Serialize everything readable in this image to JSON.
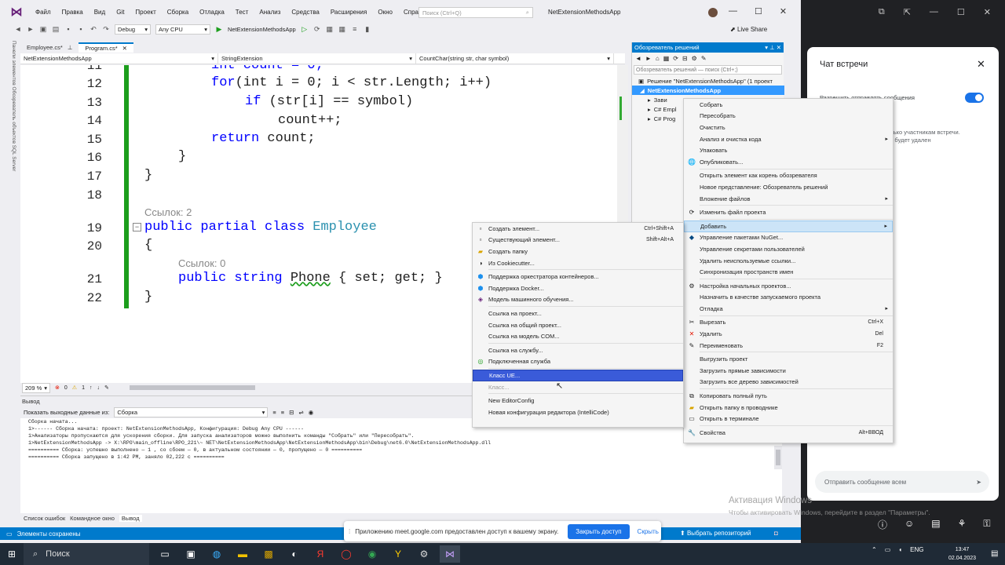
{
  "vs": {
    "menu": [
      "Файл",
      "Правка",
      "Вид",
      "Git",
      "Проект",
      "Сборка",
      "Отладка",
      "Тест",
      "Анализ",
      "Средства",
      "Расширения",
      "Окно",
      "Справка"
    ],
    "search_placeholder": "Поиск (Ctrl+Q)",
    "project_title": "NetExtensionMethodsApp",
    "toolbar": {
      "config": "Debug",
      "platform": "Any CPU",
      "run_target": "NetExtensionMethodsApp",
      "live_share": "Live Share"
    },
    "side_strip": "Панели элементов   Обозреватель объектов SQL Server",
    "tabs": [
      {
        "label": "Employee.cs*"
      },
      {
        "label": "Program.cs*"
      }
    ],
    "nav": {
      "project": "NetExtensionMethodsApp",
      "class": "StringExtension",
      "member": "CountChar(string str, char symbol)"
    },
    "code": {
      "line_numbers": [
        "11",
        "12",
        "13",
        "14",
        "15",
        "16",
        "17",
        "18",
        "19",
        "20",
        "21",
        "22"
      ],
      "l11": "int count = 0;",
      "l12_for": "for",
      "l12_rest": "(int i = 0; i < str.Length; i++)",
      "l13_if": "if",
      "l13_rest": " (str[i] == symbol)",
      "l14": "count++;",
      "l15_kw": "return",
      "l15_rest": " count;",
      "l16": "}",
      "l17": "}",
      "refs_class": "Ссылок: 2",
      "l19_kw": "public partial class",
      "l19_type": "Employee",
      "l20": "{",
      "refs_prop": "Ссылок: 0",
      "l21_kw": "public string",
      "l21_name": "Phone",
      "l21_rest": " { set; get; }",
      "l22": "}"
    },
    "zoom": "209 %",
    "errors": "0",
    "warnings": "1",
    "output": {
      "header": "Вывод",
      "show_from_label": "Показать выходные данные из:",
      "show_from_value": "Сборка",
      "lines": [
        "Сборка начата...",
        "1>------ Сборка начата: проект: NetExtensionMethodsApp, Конфигурация: Debug Any CPU ------",
        "1>Анализаторы пропускаются для ускорения сборки. Для запуска анализаторов можно выполнить команды \"Собрать\" или \"Пересобрать\".",
        "1>NetExtensionMethodsApp -> X:\\RPO\\main_offline\\RPO_221\\~ NET\\NetExtensionMethodsApp\\NetExtensionMethodsApp\\bin\\Debug\\net6.0\\NetExtensionMethodsApp.dll",
        "========== Сборка: успешно выполнено — 1 , со сбоем — 0, в актуальном состоянии — 0, пропущено — 0 ==========",
        "========== Сборка запущено в 1:42 PM, заняло 02,222 с =========="
      ]
    },
    "bottom_tabs": [
      "Список ошибок",
      "Командное окно",
      "Вывод"
    ],
    "status": "Элементы сохранены",
    "status_right": "Выбрать репозиторий"
  },
  "solution_explorer": {
    "title": "Обозреватель решений",
    "search": "Обозреватель решений — поиск (Ctrl+;)",
    "rows": [
      "Решение \"NetExtensionMethodsApp\" (1 проект",
      "NetExtensionMethodsApp",
      "Зави",
      "C# Empl",
      "C# Prog"
    ]
  },
  "context_menu": [
    {
      "icon": "",
      "label": "Собрать"
    },
    {
      "icon": "",
      "label": "Пересобрать"
    },
    {
      "icon": "",
      "label": "Очистить"
    },
    {
      "icon": "",
      "label": "Анализ и очистка кода",
      "arrow": true
    },
    {
      "icon": "",
      "label": "Упаковать"
    },
    {
      "icon": "globe-icon",
      "label": "Опубликовать..."
    },
    {
      "sep": true
    },
    {
      "icon": "",
      "label": "Открыть элемент как корень обозревателя"
    },
    {
      "icon": "",
      "label": "Новое представление: Обозреватель решений"
    },
    {
      "icon": "",
      "label": "Вложение файлов",
      "arrow": true
    },
    {
      "sep": true
    },
    {
      "icon": "refresh-icon",
      "label": "Изменить файл проекта"
    },
    {
      "sep": true
    },
    {
      "icon": "",
      "label": "Добавить",
      "arrow": true,
      "highlight": true
    },
    {
      "icon": "nuget-icon",
      "label": "Управление пакетами NuGet..."
    },
    {
      "icon": "",
      "label": "Управление секретами пользователей"
    },
    {
      "icon": "",
      "label": "Удалить неиспользуемые ссылки..."
    },
    {
      "icon": "",
      "label": "Синхронизация пространств имен"
    },
    {
      "sep": true
    },
    {
      "icon": "gear-icon",
      "label": "Настройка начальных проектов..."
    },
    {
      "icon": "",
      "label": "Назначить в качестве запускаемого проекта"
    },
    {
      "icon": "",
      "label": "Отладка",
      "arrow": true
    },
    {
      "sep": true
    },
    {
      "icon": "scissors-icon",
      "label": "Вырезать",
      "shortcut": "Ctrl+X"
    },
    {
      "icon": "delete-icon",
      "label": "Удалить",
      "shortcut": "Del"
    },
    {
      "icon": "rename-icon",
      "label": "Переименовать",
      "shortcut": "F2"
    },
    {
      "sep": true
    },
    {
      "icon": "",
      "label": "Выгрузить проект"
    },
    {
      "icon": "",
      "label": "Загрузить прямые зависимости"
    },
    {
      "icon": "",
      "label": "Загрузить все дерево зависимостей"
    },
    {
      "sep": true
    },
    {
      "icon": "copy-icon",
      "label": "Копировать полный путь"
    },
    {
      "icon": "folder-icon",
      "label": "Открыть папку в проводнике"
    },
    {
      "icon": "terminal-icon",
      "label": "Открыть в терминале"
    },
    {
      "sep": true
    },
    {
      "icon": "wrench-icon",
      "label": "Свойства",
      "shortcut": "Alt+ВВОД"
    }
  ],
  "submenu": [
    {
      "icon": "new-item-icon",
      "label": "Создать элемент...",
      "shortcut": "Ctrl+Shift+A"
    },
    {
      "icon": "existing-item-icon",
      "label": "Существующий элемент...",
      "shortcut": "Shift+Alt+A"
    },
    {
      "icon": "folder-icon",
      "label": "Создать папку"
    },
    {
      "icon": "cookiecutter-icon",
      "label": "Из Cookiecutter..."
    },
    {
      "sep": true
    },
    {
      "icon": "container-icon",
      "label": "Поддержка оркестратора контейнеров..."
    },
    {
      "icon": "docker-icon",
      "label": "Поддержка Docker..."
    },
    {
      "icon": "ml-icon",
      "label": "Модель машинного обучения..."
    },
    {
      "sep": true
    },
    {
      "icon": "",
      "label": "Ссылка на проект..."
    },
    {
      "icon": "",
      "label": "Ссылка на общий проект..."
    },
    {
      "icon": "",
      "label": "Ссылка на модель COM..."
    },
    {
      "sep": true
    },
    {
      "icon": "",
      "label": "Ссылка на службу..."
    },
    {
      "icon": "connected-service-icon",
      "label": "Подключенная служба"
    },
    {
      "sep": true
    },
    {
      "icon": "",
      "label": "Класс UE...",
      "highlight": true
    },
    {
      "icon": "",
      "label": "Класс...",
      "disabled": true
    },
    {
      "sep": true
    },
    {
      "icon": "",
      "label": "New EditorConfig"
    },
    {
      "icon": "",
      "label": "Новая конфигурация редактора (IntelliCode)"
    }
  ],
  "meet": {
    "title": "Чат встречи",
    "toggle_label": "Разрешить отправлять сообщения",
    "info": "только участникам встречи. чат будет удален",
    "message_placeholder": "Отправить сообщение всем"
  },
  "activation": {
    "line1": "Активация Windows",
    "line2": "Чтобы активировать Windows, перейдите в раздел \"Параметры\"."
  },
  "banner": {
    "text": "Приложению meet.google.com предоставлен доступ к вашему экрану.",
    "stop": "Закрыть доступ",
    "hide": "Скрыть"
  },
  "taskbar": {
    "search": "Поиск",
    "lang": "ENG",
    "time": "13:47",
    "date": "02.04.2023"
  }
}
